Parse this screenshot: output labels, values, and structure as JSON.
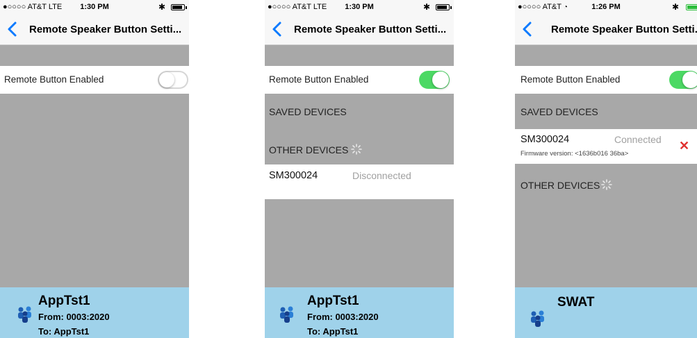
{
  "screens": [
    {
      "status": {
        "carrier": "●○○○○ AT&T  LTE",
        "time": "1:30 PM",
        "bt": "✱",
        "battery_level": 0.85,
        "battery_color": "#000000"
      },
      "nav": {
        "title": "Remote Speaker Button Setti..."
      },
      "remote_label": "Remote Button Enabled",
      "toggle_on": false,
      "footer": {
        "title": "AppTst1",
        "line1": "From: 0003:2020",
        "line2": "To: AppTst1"
      }
    },
    {
      "status": {
        "carrier": "●○○○○ AT&T  LTE",
        "time": "1:30 PM",
        "bt": "✱",
        "battery_level": 0.85,
        "battery_color": "#000000"
      },
      "nav": {
        "title": "Remote Speaker Button Setti..."
      },
      "remote_label": "Remote Button Enabled",
      "toggle_on": true,
      "saved_devices": "SAVED DEVICES",
      "other_devices": "OTHER DEVICES",
      "device": {
        "name": "SM300024",
        "status": "Disconnected"
      },
      "footer": {
        "title": "AppTst1",
        "line1": "From: 0003:2020",
        "line2": "To: AppTst1"
      }
    },
    {
      "status": {
        "carrier": "●○○○○ AT&T",
        "time": "1:26 PM",
        "bt": "✱",
        "battery_level": 0.9,
        "battery_color": "#2bbd3a"
      },
      "nav": {
        "title": "Remote Speaker Button Setti..."
      },
      "remote_label": "Remote Button Enabled",
      "toggle_on": true,
      "saved_devices": "SAVED DEVICES",
      "device": {
        "name": "SM300024",
        "status": "Connected",
        "firmware": "Firmware version: <1636b016 36ba>"
      },
      "other_devices": "OTHER DEVICES",
      "footer": {
        "title": "SWAT"
      }
    }
  ]
}
